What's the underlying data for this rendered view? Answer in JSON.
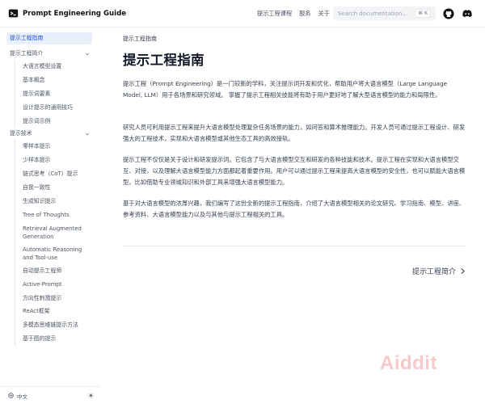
{
  "header": {
    "site_title": "Prompt Engineering Guide",
    "nav": [
      "提示工程课程",
      "服务",
      "关于"
    ],
    "search_placeholder": "Search documentation...",
    "search_shortcut": "⌘ K"
  },
  "sidebar": {
    "top_item": "提示工程指南",
    "sections": [
      {
        "label": "提示工程简介",
        "items": [
          "大语言模型设置",
          "基本概念",
          "提示词要素",
          "设计提示的通用技巧",
          "提示词示例"
        ]
      },
      {
        "label": "提示技术",
        "items": [
          "零样本提示",
          "少样本提示",
          "链式思考（CoT）提示",
          "自我一致性",
          "生成知识提示",
          "Tree of Thoughts",
          "Retrieval Augmented Generation",
          "Automatic Reasoning and Tool-use",
          "自动提示工程师",
          "Active-Prompt",
          "方向性刺激提示",
          "ReAct框架",
          "多模态思维链提示方法",
          "基于图的提示"
        ]
      }
    ],
    "language": "中文"
  },
  "main": {
    "breadcrumb": "提示工程指南",
    "title": "提示工程指南",
    "paragraphs": [
      "提示工程（Prompt Engineering）是一门较新的学科，关注提示词开发和优化，帮助用户将大语言模型（Large Language Model, LLM）用于各场景和研究领域。 掌握了提示工程相关技能将有助于用户更好地了解大型语言模型的能力和局限性。",
      "研究人员可利用提示工程来提升大语言模型处理复杂任务场景的能力，如问答和算术推理能力。开发人员可通过提示工程设计、研发强大的工程技术，实现和大语言模型或其他生态工具的高效接轨。",
      "提示工程不仅仅是关于设计和研发提示词。它包含了与大语言模型交互和研发的各种技能和技术。提示工程在实现和大语言模型交互、对接，以及理解大语言模型能力方面都起着重要作用。用户可以通过提示工程来提高大语言模型的安全性，也可以赋能大语言模型，比如借助专业领域知识和外部工具来增强大语言模型能力。",
      "基于对大语言模型的浓厚兴趣，我们编写了这份全新的提示工程指南，介绍了大语言模型相关的论文研究、学习指南、模型、讲座、参考资料、大语言模型能力以及与其他与提示工程相关的工具。"
    ],
    "next_label": "提示工程简介"
  },
  "watermark": "Aiddit",
  "colors": {
    "accent": "#1d4ed8",
    "active_bg": "#e8f1fb",
    "watermark": "#f7c9cc"
  }
}
